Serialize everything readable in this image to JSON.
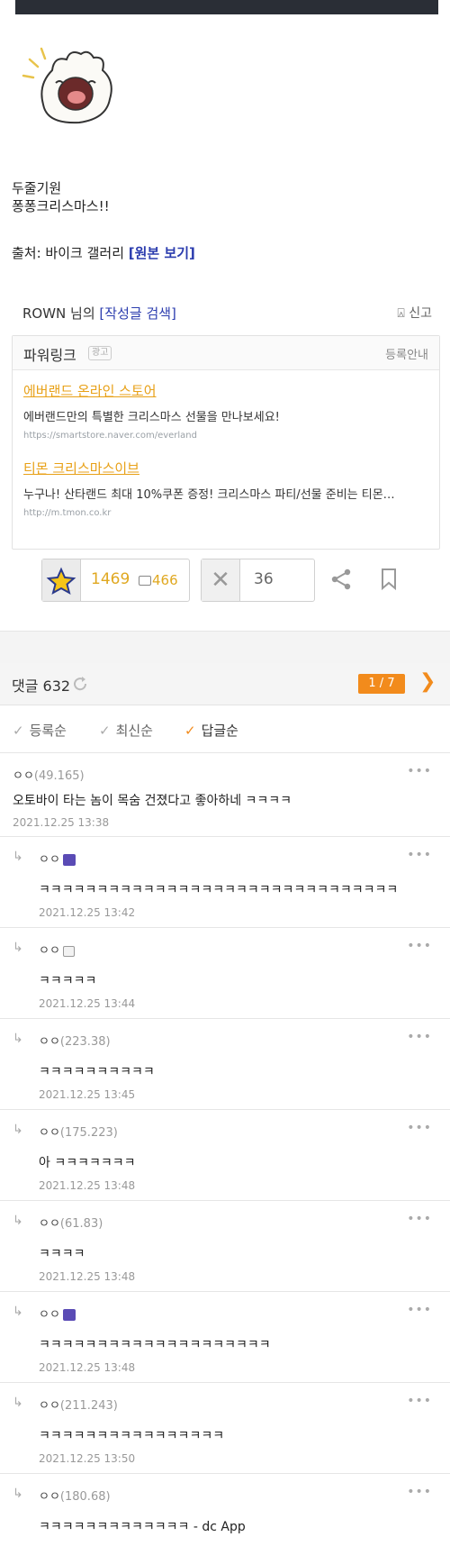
{
  "post": {
    "line1": "두줄기원",
    "line2": "퐁퐁크리스마스!!",
    "source_prefix": "출처: 바이크 갤러리 ",
    "source_link": "[원본 보기]"
  },
  "author": {
    "name": "ROWN 님의 ",
    "search_link": "[작성글 검색]",
    "report": "신고"
  },
  "powerlink": {
    "title": "파워링크",
    "badge": "광고",
    "guide": "등록안내",
    "ads": [
      {
        "title": "에버랜드 온라인 스토어",
        "desc": "에버랜드만의 특별한 크리스마스 선물을 만나보세요!",
        "url": "https://smartstore.naver.com/everland"
      },
      {
        "title": "티몬 크리스마스이브",
        "desc": "누구나! 산타랜드 최대 10%쿠폰 증정! 크리스마스 파티/선물 준비는 티몬…",
        "url": "http://m.tmon.co.kr"
      }
    ]
  },
  "votes": {
    "up": "1469",
    "fixed": "466",
    "down": "36"
  },
  "comments_header": {
    "label": "댓글 632",
    "page": "1 / 7"
  },
  "sort": [
    "등록순",
    "최신순",
    "답글순"
  ],
  "comments": [
    {
      "name": "ㅇㅇ",
      "ip": "(49.165)",
      "text": "오토바이 타는 놈이 목숨 건졌다고 좋아하네 ㅋㅋㅋㅋ",
      "date": "2021.12.25 13:38"
    },
    {
      "name": "ㅇㅇ",
      "ip": "",
      "text": "ㅋㅋㅋㅋㅋㅋㅋㅋㅋㅋㅋㅋㅋㅋㅋㅋㅋㅋㅋㅋㅋㅋㅋㅋㅋㅋㅋㅋㅋㅋㅋ",
      "date": "2021.12.25 13:42"
    },
    {
      "name": "ㅇㅇ",
      "ip": "",
      "text": "ㅋㅋㅋㅋㅋ",
      "date": "2021.12.25 13:44"
    },
    {
      "name": "ㅇㅇ",
      "ip": "(223.38)",
      "text": "ㅋㅋㅋㅋㅋㅋㅋㅋㅋㅋ",
      "date": "2021.12.25 13:45"
    },
    {
      "name": "ㅇㅇ",
      "ip": "(175.223)",
      "text": "아 ㅋㅋㅋㅋㅋㅋㅋ",
      "date": "2021.12.25 13:48"
    },
    {
      "name": "ㅇㅇ",
      "ip": "(61.83)",
      "text": "ㅋㅋㅋㅋ",
      "date": "2021.12.25 13:48"
    },
    {
      "name": "ㅇㅇ",
      "ip": "",
      "text": "ㅋㅋㅋㅋㅋㅋㅋㅋㅋㅋㅋㅋㅋㅋㅋㅋㅋㅋㅋㅋ",
      "date": "2021.12.25 13:48"
    },
    {
      "name": "ㅇㅇ",
      "ip": "(211.243)",
      "text": "ㅋㅋㅋㅋㅋㅋㅋㅋㅋㅋㅋㅋㅋㅋㅋㅋ",
      "date": "2021.12.25 13:50"
    },
    {
      "name": "ㅇㅇ",
      "ip": "(180.68)",
      "text": "ㅋㅋㅋㅋㅋㅋㅋㅋㅋㅋㅋㅋㅋ - dc App",
      "date": ""
    }
  ]
}
